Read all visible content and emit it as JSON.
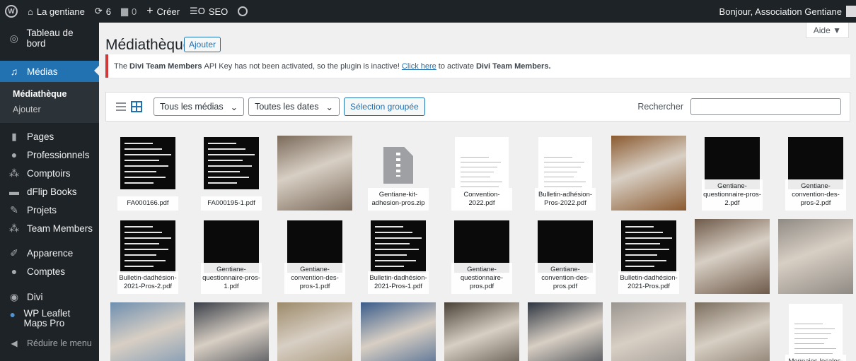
{
  "adminbar": {
    "site_name": "La gentiane",
    "updates_count": "6",
    "comments_count": "0",
    "new_label": "Créer",
    "seo_label": "SEO",
    "greeting": "Bonjour, Association Gentiane"
  },
  "sidebar": {
    "items": [
      {
        "label": "Tableau de bord",
        "icon": "dashboard-icon"
      },
      {
        "label": "Médias",
        "icon": "media-icon"
      },
      {
        "label": "Pages",
        "icon": "pages-icon"
      },
      {
        "label": "Professionnels",
        "icon": "user-icon"
      },
      {
        "label": "Comptoirs",
        "icon": "groups-icon"
      },
      {
        "label": "dFlip Books",
        "icon": "book-icon"
      },
      {
        "label": "Projets",
        "icon": "pin-icon"
      },
      {
        "label": "Team Members",
        "icon": "groups-icon"
      },
      {
        "label": "Apparence",
        "icon": "appearance-icon"
      },
      {
        "label": "Comptes",
        "icon": "user-icon"
      },
      {
        "label": "Divi",
        "icon": "divi-icon"
      },
      {
        "label": "WP Leaflet Maps Pro",
        "icon": "map-icon"
      },
      {
        "label": "Réduire le menu",
        "icon": "collapse-icon"
      }
    ],
    "submenu": [
      "Médiathèque",
      "Ajouter"
    ]
  },
  "main": {
    "title": "Médiathèque",
    "add_button": "Ajouter",
    "help_label": "Aide ▼",
    "notice": {
      "part1": "The",
      "plugin1": "Divi Team Members",
      "part2": "API Key has not been activated, so the plugin is inactive!",
      "link": "Click here",
      "part3": "to activate",
      "plugin2": "Divi Team Members."
    },
    "toolbar": {
      "filter_media": "Tous les médias",
      "filter_dates": "Toutes les dates",
      "bulk_select": "Sélection groupée",
      "search_label": "Rechercher"
    },
    "files": [
      {
        "name": "FA000166.pdf",
        "kind": "black"
      },
      {
        "name": "FA000195-1.pdf",
        "kind": "black"
      },
      {
        "name": "",
        "kind": "photo",
        "color": "#7a6a5a"
      },
      {
        "name": "Gentiane-kit-adhesion-pros.zip",
        "kind": "zip"
      },
      {
        "name": "Convention-2022.pdf",
        "kind": "white"
      },
      {
        "name": "Bulletin-adhésion-Pros-2022.pdf",
        "kind": "white"
      },
      {
        "name": "",
        "kind": "photo",
        "color": "#8a5a30"
      },
      {
        "name": "Gentiane-questionnaire-pros-2.pdf",
        "kind": "black"
      },
      {
        "name": "Gentiane-convention-des-pros-2.pdf",
        "kind": "black"
      },
      {
        "name": "Bulletin-dadhésion-2021-Pros-2.pdf",
        "kind": "black"
      },
      {
        "name": "Gentiane-questionnaire-pros-1.pdf",
        "kind": "black"
      },
      {
        "name": "Gentiane-convention-des-pros-1.pdf",
        "kind": "black"
      },
      {
        "name": "Bulletin-dadhésion-2021-Pros-1.pdf",
        "kind": "black"
      },
      {
        "name": "Gentiane-questionnaire-pros.pdf",
        "kind": "black"
      },
      {
        "name": "Gentiane-convention-des-pros.pdf",
        "kind": "black"
      },
      {
        "name": "Bulletin-dadhésion-2021-Pros.pdf",
        "kind": "black"
      },
      {
        "name": "",
        "kind": "photo",
        "color": "#6e5a4a"
      },
      {
        "name": "",
        "kind": "photo",
        "color": "#8f8a84"
      },
      {
        "name": "",
        "kind": "photo",
        "color": "#6f8fb0"
      },
      {
        "name": "",
        "kind": "photo",
        "color": "#3a3f48"
      },
      {
        "name": "",
        "kind": "photo",
        "color": "#9c8a6a"
      },
      {
        "name": "",
        "kind": "photo",
        "color": "#3a5c8a"
      },
      {
        "name": "",
        "kind": "photo",
        "color": "#4a4238"
      },
      {
        "name": "",
        "kind": "photo",
        "color": "#2e3540"
      },
      {
        "name": "",
        "kind": "photo",
        "color": "#9a9590"
      },
      {
        "name": "",
        "kind": "photo",
        "color": "#7a6e5e"
      },
      {
        "name": "Monnaies-locales-monnaies-inte",
        "kind": "white"
      }
    ]
  }
}
